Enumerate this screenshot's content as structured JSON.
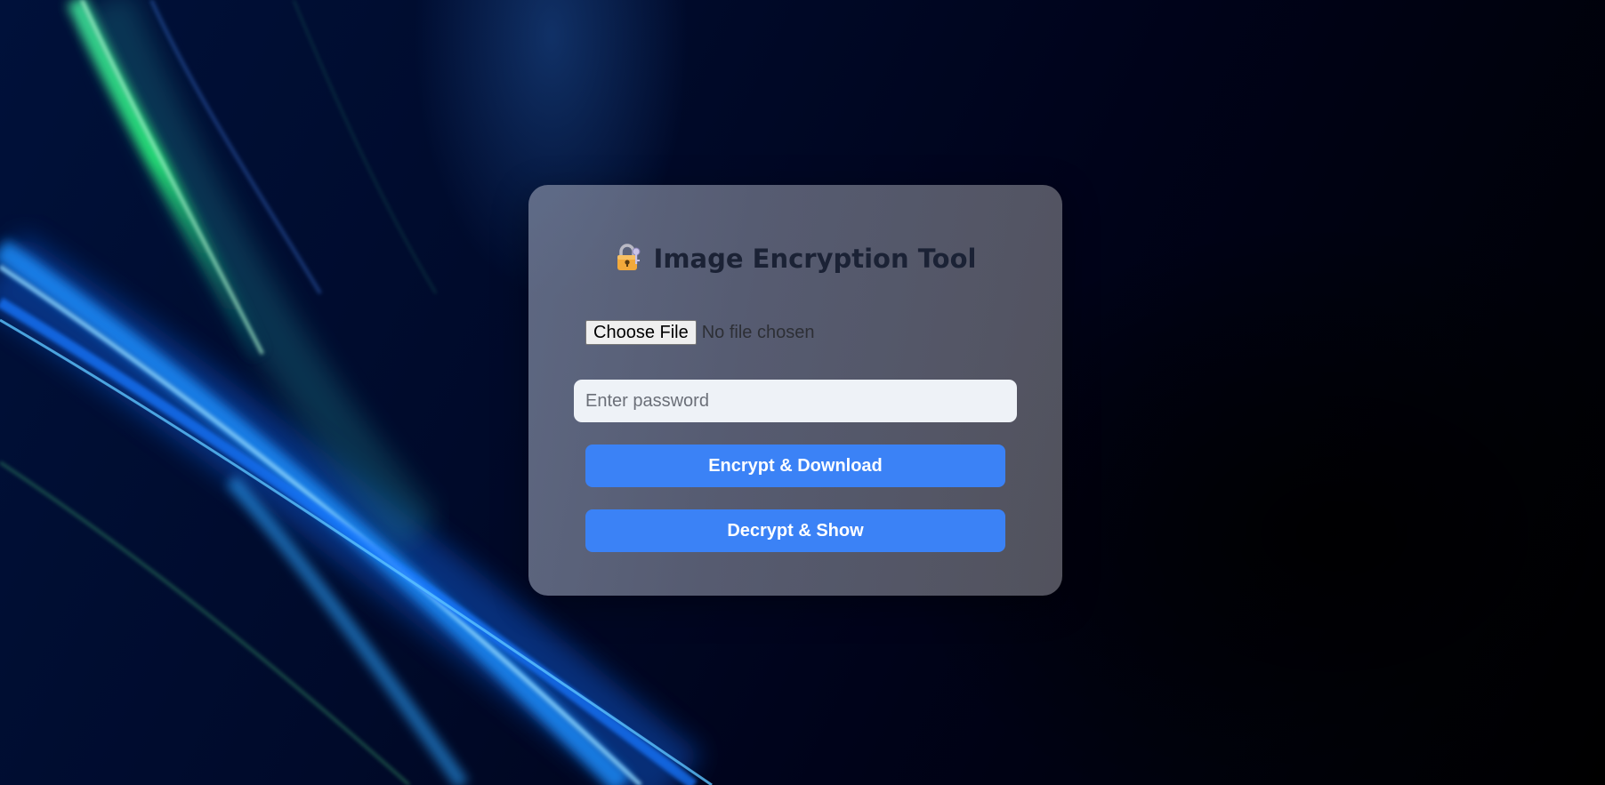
{
  "app": {
    "title": "Image Encryption Tool",
    "icon": "lock-with-key-icon"
  },
  "form": {
    "file_button_label": "Choose File",
    "file_status": "No file chosen",
    "password_placeholder": "Enter password",
    "password_value": ""
  },
  "actions": {
    "encrypt_label": "Encrypt & Download",
    "decrypt_label": "Decrypt & Show"
  },
  "colors": {
    "accent": "#3b82f6",
    "title_text": "#1b2235",
    "input_bg": "#eef2f7"
  }
}
